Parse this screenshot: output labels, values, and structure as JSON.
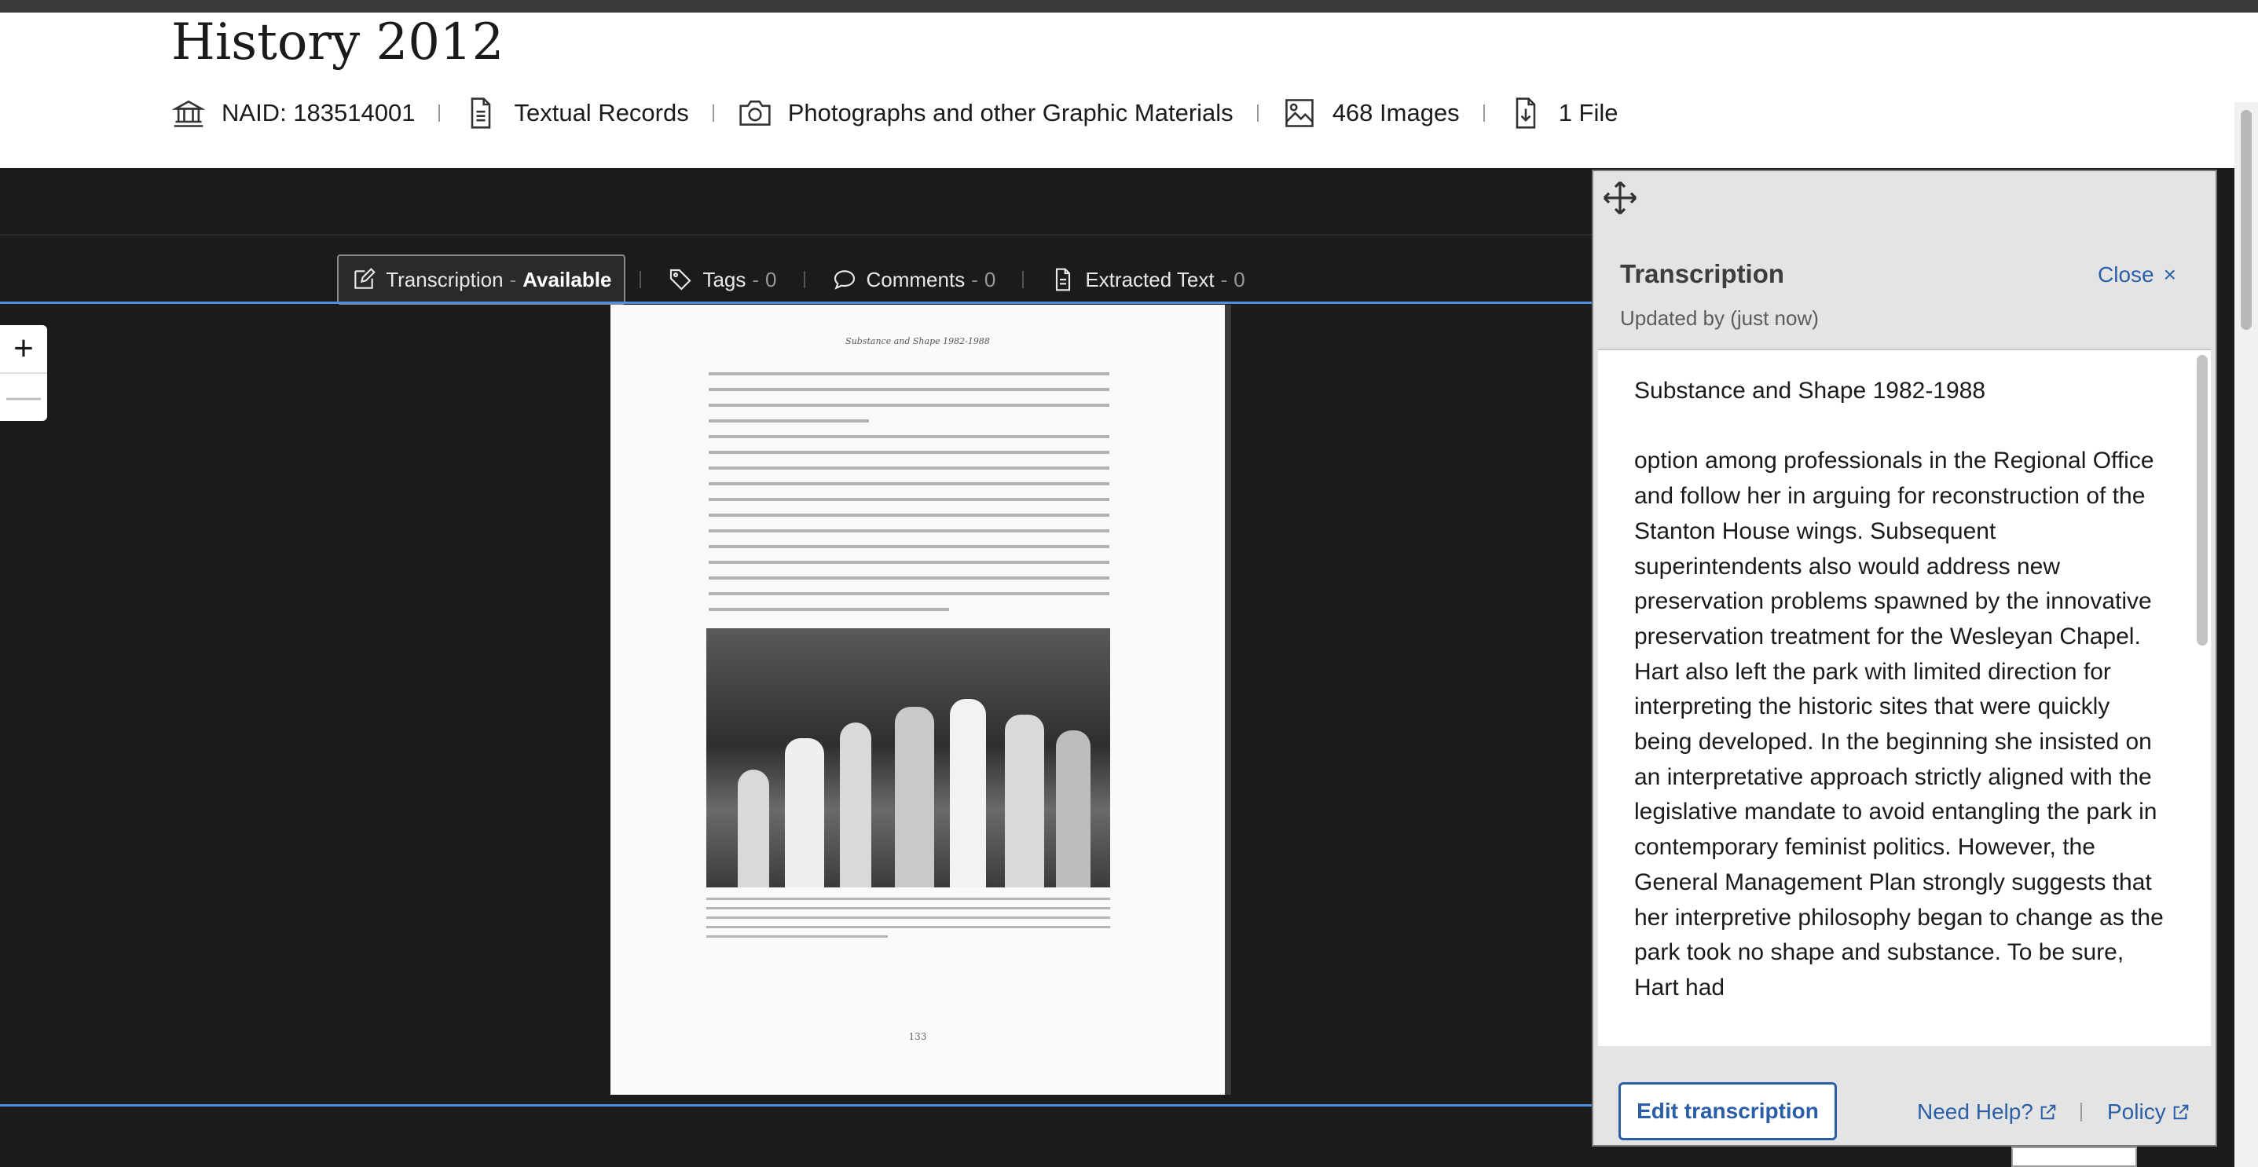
{
  "header": {
    "title": "History 2012",
    "meta": [
      {
        "icon": "archive-building-icon",
        "label": "NAID: 183514001"
      },
      {
        "icon": "document-icon",
        "label": "Textual Records"
      },
      {
        "icon": "camera-icon",
        "label": "Photographs and other Graphic Materials"
      },
      {
        "icon": "image-icon",
        "label": "468 Images"
      },
      {
        "icon": "file-download-icon",
        "label": "1 File"
      }
    ]
  },
  "viewer": {
    "tabs": {
      "transcription": {
        "label": "Transcription",
        "dash": "-",
        "status": "Available"
      },
      "tags": {
        "label": "Tags",
        "dash": "-",
        "count": "0"
      },
      "comments": {
        "label": "Comments",
        "dash": "-",
        "count": "0"
      },
      "extracted": {
        "label": "Extracted Text",
        "dash": "-",
        "count": "0"
      }
    },
    "zoom": {
      "in": "+",
      "out": "—"
    },
    "page": {
      "running_head": "Substance and Shape 1982-1988",
      "page_number": "133"
    }
  },
  "panel": {
    "title": "Transcription",
    "close_label": "Close",
    "close_icon": "×",
    "updated": "Updated by (just now)",
    "text": "Substance and Shape 1982-1988\n\noption among professionals in the Regional Office and follow her in arguing for reconstruction of the Stanton House wings. Subsequent superintendents also would address new preservation problems spawned by the innovative preservation treatment for the Wesleyan Chapel.\nHart also left the park with limited direction for interpreting the historic sites that were quickly being developed. In the beginning she insisted on an interpretative approach strictly aligned with the legislative mandate to avoid entangling the park in contemporary feminist politics. However, the General Management Plan strongly suggests that her interpretive philosophy began to change as the park took no shape and substance. To be sure, Hart had",
    "edit_button": "Edit transcription",
    "help_link": "Need Help?",
    "policy_link": "Policy"
  }
}
